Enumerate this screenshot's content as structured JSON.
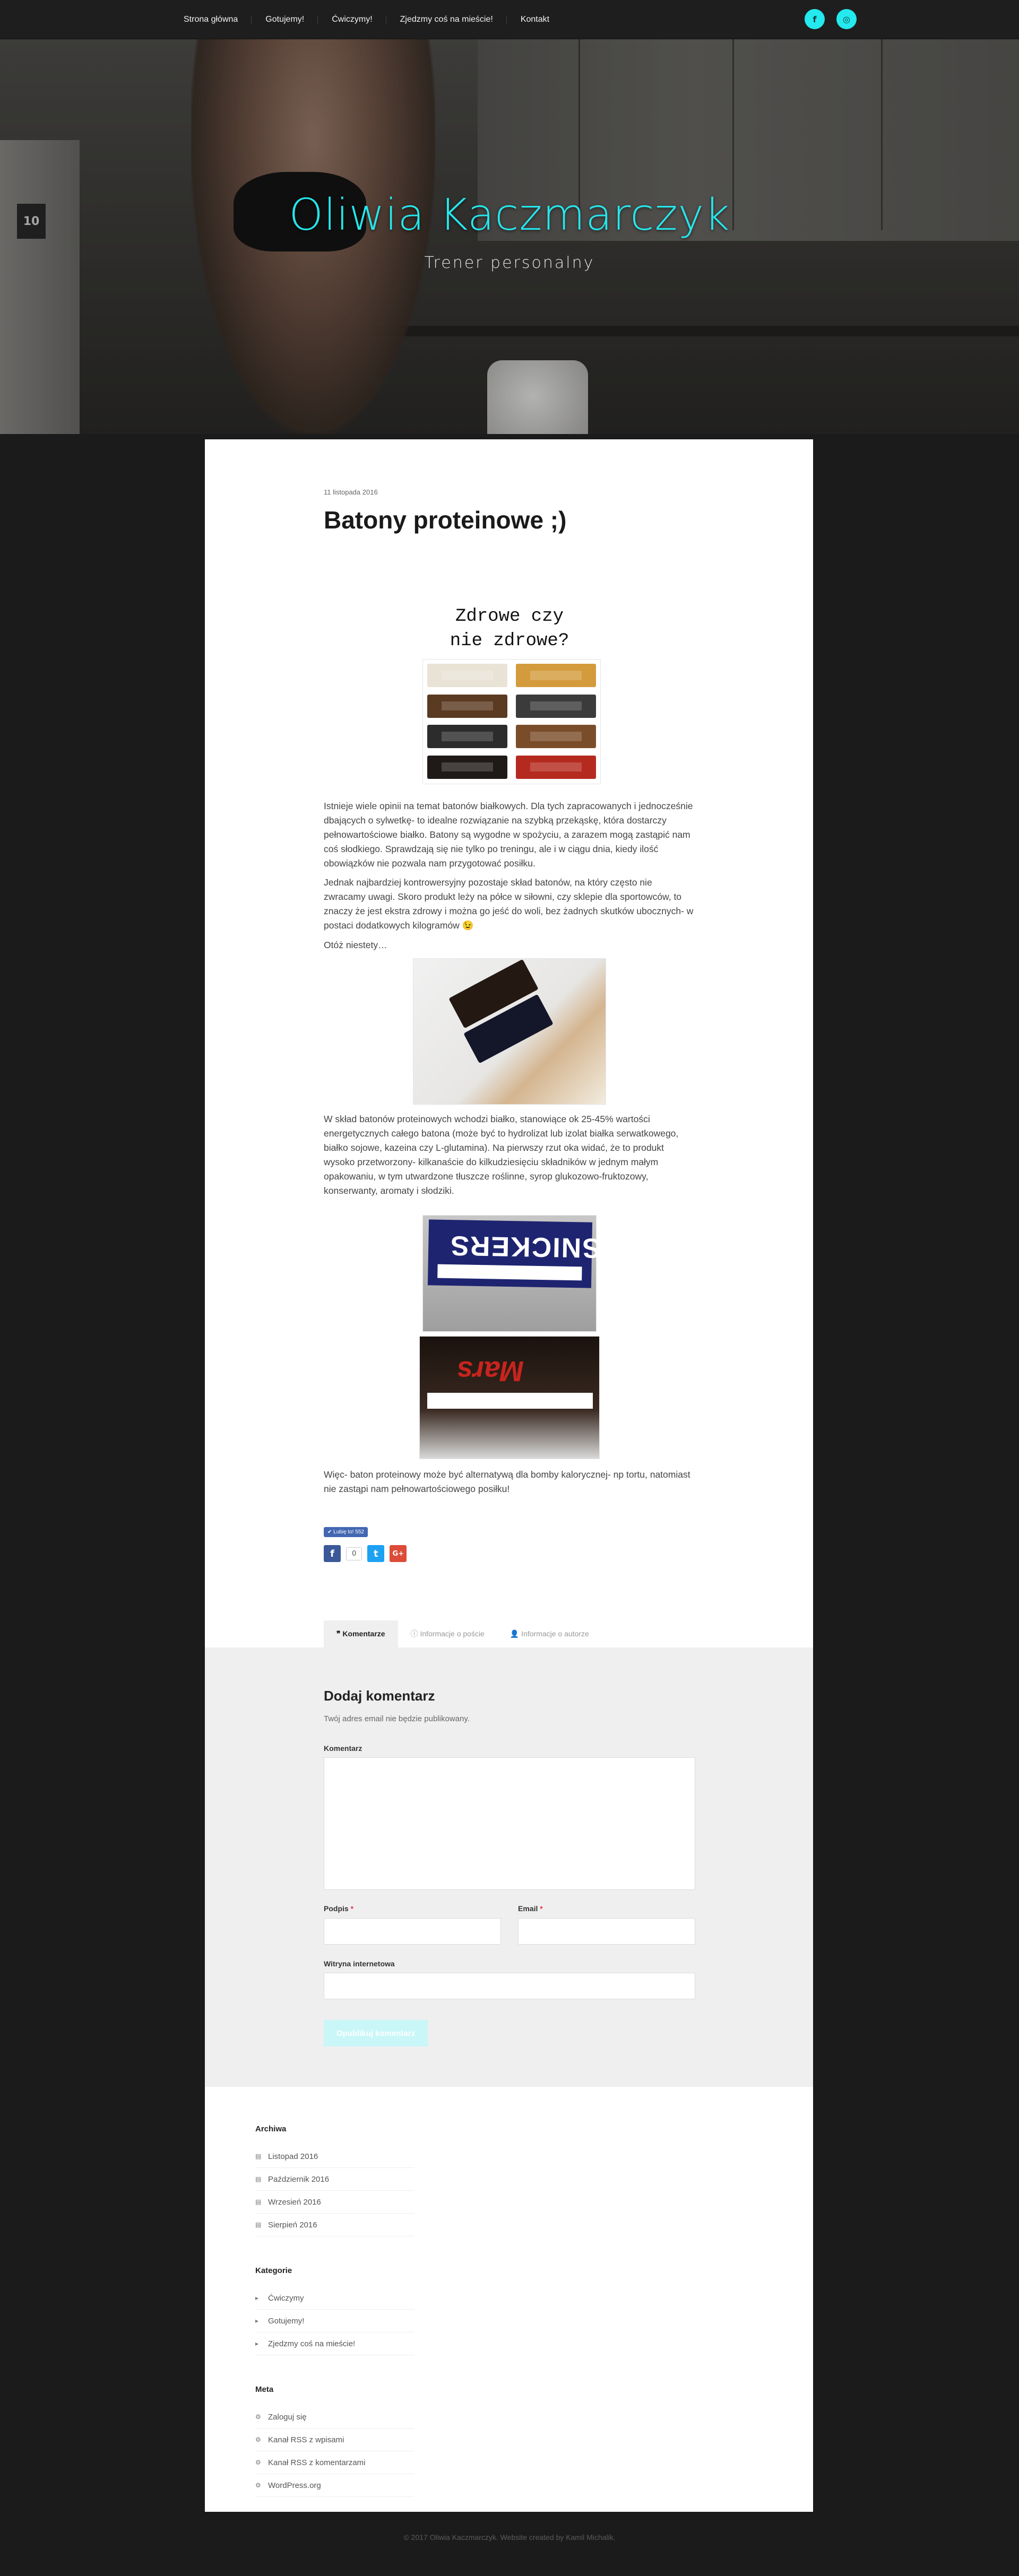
{
  "nav": {
    "items": [
      "Strona główna",
      "Gotujemy!",
      "Ćwiczymy!",
      "Zjedzmy coś na mieście!",
      "Kontakt"
    ],
    "social": [
      {
        "icon": "facebook-icon",
        "glyph": "f"
      },
      {
        "icon": "instagram-icon",
        "glyph": "◎"
      }
    ],
    "accent_color": "#24e9ee"
  },
  "hero": {
    "title": "Oliwia Kaczmarczyk",
    "subtitle": "Trener personalny",
    "fridge_badge": "10"
  },
  "post": {
    "date": "11 listopada 2016",
    "title": "Batony proteinowe ;)",
    "image_title_line1": "Zdrowe czy",
    "image_title_line2": "nie zdrowe?",
    "paragraph1": "Istnieje wiele opinii na temat batonów białkowych. Dla tych zapracowanych i jednocześnie dbających o sylwetkę- to idealne rozwiązanie na szybką przekąskę, która dostarczy pełnowartościowe białko. Batony są wygodne w spożyciu, a zarazem mogą zastąpić nam coś słodkiego. Sprawdzają się nie tylko po treningu, ale i w ciągu dnia, kiedy ilość obowiązków nie pozwala nam przygotować posiłku.",
    "paragraph2": "Jednak najbardziej kontrowersyjny pozostaje skład batonów, na który często nie zwracamy uwagi. Skoro produkt leży na półce w siłowni, czy sklepie dla sportowców, to znaczy że jest ekstra zdrowy i można go jeść do woli, bez żadnych skutków ubocznych- w postaci dodatkowych kilogramów 😉",
    "paragraph3": "Otóż niestety…",
    "paragraph4": "W skład batonów proteinowych wchodzi białko, stanowiące ok 25-45% wartości energetycznych całego batona (może być to hydrolizat lub izolat białka serwatkowego, białko sojowe, kazeina czy L-glutamina). Na pierwszy rzut oka widać, że to produkt wysoko przetworzony- kilkanaście do kilkudziesięciu składników w jednym małym opakowaniu, w tym utwardzone tłuszcze roślinne, syrop glukozowo-fruktozowy, konserwanty, aromaty i słodziki.",
    "paragraph5": "Więc- baton proteinowy może być alternatywą dla bomby kalorycznej- np tortu, natomiast nie zastąpi nam pełnowartościowego posiłku!",
    "snickers_logo": "SNICKERS",
    "mars_logo": "Mars",
    "bar_colors": [
      "#e9e3d6",
      "#d49b3c",
      "#5b3a22",
      "#3b3b3b",
      "#2c2c2c",
      "#7a4d2a",
      "#1f1a18",
      "#b52a1f"
    ]
  },
  "social_share": {
    "like_label": "✔ Lubię to! 552",
    "share_count": "0",
    "icons": [
      {
        "name": "facebook-share-icon",
        "glyph": "f",
        "color": "#3b5998"
      },
      {
        "name": "twitter-share-icon",
        "glyph": "t",
        "color": "#1da1f2"
      },
      {
        "name": "google-plus-share-icon",
        "glyph": "G+",
        "color": "#dd4b39"
      }
    ]
  },
  "tabs": [
    "❞ Komentarze",
    "ⓘ Informacje o poście",
    "👤 Informacje o autorze"
  ],
  "comment": {
    "heading": "Dodaj komentarz",
    "note": "Twój adres email nie będzie publikowany.",
    "label_comment": "Komentarz",
    "label_name": "Podpis",
    "label_email": "Email",
    "label_website": "Witryna internetowa",
    "required_mark": "*",
    "submit_label": "Opublikuj komentarz"
  },
  "widgets": {
    "archives_title": "Archiwa",
    "archives": [
      "Listopad 2016",
      "Październik 2016",
      "Wrzesień 2016",
      "Sierpień 2016"
    ],
    "categories_title": "Kategorie",
    "categories": [
      "Ćwiczymy",
      "Gotujemy!",
      "Zjedzmy coś na mieście!"
    ],
    "meta_title": "Meta",
    "meta": [
      "Zaloguj się",
      "Kanał RSS z wpisami",
      "Kanał RSS z komentarzami",
      "WordPress.org"
    ]
  },
  "footer": {
    "text": "© 2017 Oliwia Kaczmarczyk. Website created by Kamil Michalik."
  }
}
